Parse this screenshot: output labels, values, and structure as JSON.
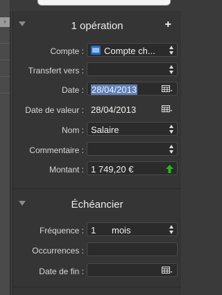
{
  "operation": {
    "title": "1 opération",
    "add_icon": "plus-icon",
    "fields": [
      {
        "label": "Compte :",
        "value": "Compte ch...",
        "icon": "account-icon",
        "kind": "popup"
      },
      {
        "label": "Transfert vers :",
        "value": "",
        "kind": "popup"
      },
      {
        "label": "Date :",
        "value": "28/04/2013",
        "kind": "date",
        "selected": true
      },
      {
        "label": "Date de valeur :",
        "value": "28/04/2013",
        "kind": "date"
      },
      {
        "label": "Nom :",
        "value": "Salaire",
        "kind": "combo"
      },
      {
        "label": "Commentaire :",
        "value": "",
        "kind": "combo"
      },
      {
        "label": "Montant :",
        "value": "1 749,20 €",
        "kind": "amount",
        "arrow_icon": "green-up-arrow-icon",
        "arrow_color": "#25b820"
      }
    ]
  },
  "schedule": {
    "title": "Échéancier",
    "fields": [
      {
        "label": "Fréquence :",
        "value": "1",
        "unit": "mois",
        "kind": "frequency"
      },
      {
        "label": "Occurrences :",
        "value": "",
        "kind": "text"
      },
      {
        "label": "Date de fin :",
        "value": "",
        "kind": "date"
      }
    ]
  },
  "colors": {
    "selection": "#5e7fb8",
    "panel": "#353535",
    "field": "#2b2b2b"
  }
}
